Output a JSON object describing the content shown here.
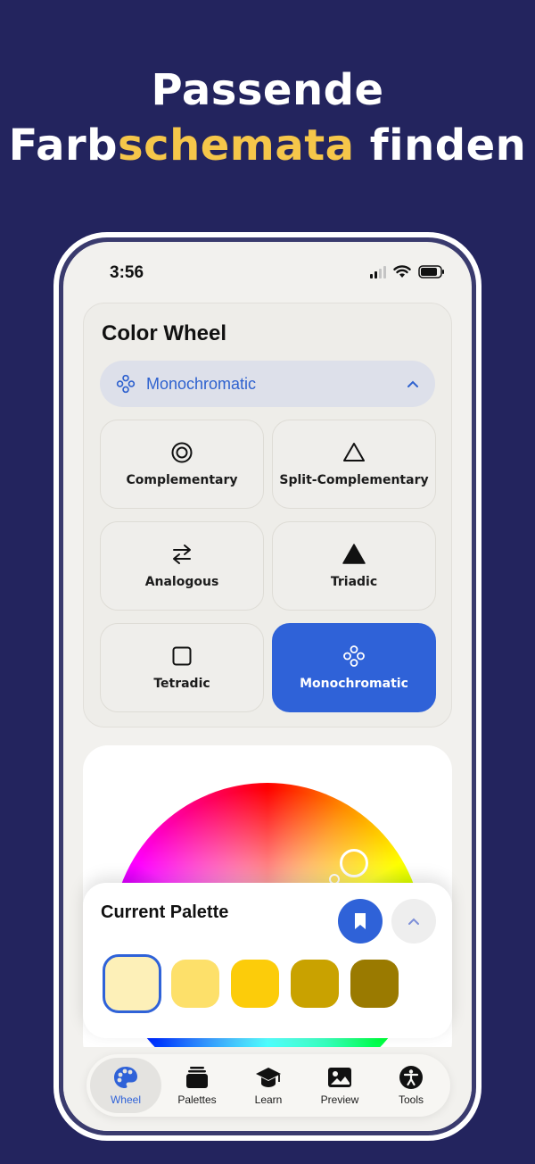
{
  "headline": {
    "line1": "Passende",
    "line2_prefix": "Farb",
    "line2_accent": "schemata",
    "line2_suffix": " finden"
  },
  "status_bar": {
    "time": "3:56",
    "icons": [
      "signal-icon",
      "wifi-icon",
      "battery-icon"
    ]
  },
  "color_wheel_card": {
    "title": "Color Wheel",
    "selected_scheme": "Monochromatic",
    "options": [
      {
        "label": "Complementary",
        "icon": "target-icon",
        "active": false
      },
      {
        "label": "Split-Complementary",
        "icon": "triangle-outline-icon",
        "active": false
      },
      {
        "label": "Analogous",
        "icon": "arrows-swap-icon",
        "active": false
      },
      {
        "label": "Triadic",
        "icon": "triangle-filled-icon",
        "active": false
      },
      {
        "label": "Tetradic",
        "icon": "square-icon",
        "active": false
      },
      {
        "label": "Monochromatic",
        "icon": "circles-cluster-icon",
        "active": true
      }
    ]
  },
  "palette": {
    "title": "Current Palette",
    "swatches": [
      "#fdf0b8",
      "#fde06a",
      "#fccc0a",
      "#c9a200",
      "#9a7a00"
    ],
    "selected_index": 0
  },
  "tabs": [
    {
      "label": "Wheel",
      "icon": "palette-icon",
      "active": true
    },
    {
      "label": "Palettes",
      "icon": "stack-icon",
      "active": false
    },
    {
      "label": "Learn",
      "icon": "graduation-cap-icon",
      "active": false
    },
    {
      "label": "Preview",
      "icon": "photo-icon",
      "active": false
    },
    {
      "label": "Tools",
      "icon": "accessibility-icon",
      "active": false
    }
  ],
  "colors": {
    "background": "#23245e",
    "accent": "#2f62d8",
    "headline_accent": "#f5c64a"
  }
}
